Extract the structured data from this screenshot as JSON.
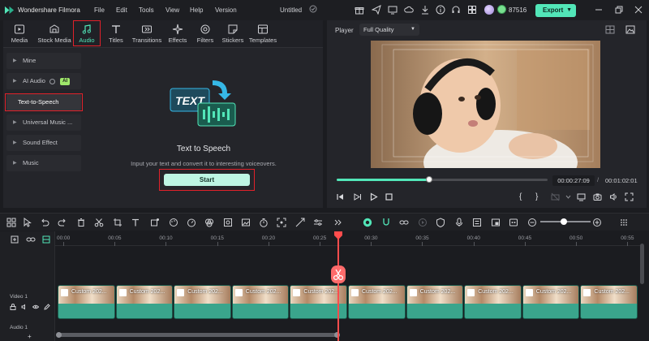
{
  "app": {
    "name": "Wondershare Filmora",
    "menu": [
      "File",
      "Edit",
      "Tools",
      "View",
      "Help",
      "Version"
    ],
    "doc_title": "Untitled",
    "credits": "87516",
    "export_label": "Export"
  },
  "media_tabs": [
    "Media",
    "Stock Media",
    "Audio",
    "Titles",
    "Transitions",
    "Effects",
    "Filters",
    "Stickers",
    "Templates"
  ],
  "active_tab": "Audio",
  "sidebar": {
    "items": [
      {
        "label": "Mine"
      },
      {
        "label": "AI Audio",
        "badge": "AI"
      },
      {
        "label": "Text-to-Speech"
      },
      {
        "label": "Universal Music ..."
      },
      {
        "label": "Sound Effect"
      },
      {
        "label": "Music"
      }
    ],
    "selected": "Text-to-Speech"
  },
  "tts": {
    "illustration_text": "TEXT",
    "title": "Text to Speech",
    "description": "Input your text and convert it to interesting voiceovers.",
    "start_label": "Start"
  },
  "player": {
    "label": "Player",
    "quality": "Full Quality",
    "current_time": "00:00:27:09",
    "total_time": "00:01:02:01",
    "progress": 0.44
  },
  "timeline": {
    "ticks": [
      "00:00",
      "00:05",
      "00:10",
      "00:15",
      "00:20",
      "00:25",
      "00:30",
      "00:35",
      "00:40",
      "00:45",
      "00:50",
      "00:55"
    ],
    "tracks": [
      {
        "label": "Video 1"
      },
      {
        "label": "Audio 1"
      }
    ],
    "clip_title": "Custom 202...",
    "clip_count": 10,
    "playhead_time": "00:00:27:09"
  },
  "colors": {
    "accent": "#52e6b8",
    "highlight": "#e1212a",
    "playhead": "#ff4d4d"
  }
}
